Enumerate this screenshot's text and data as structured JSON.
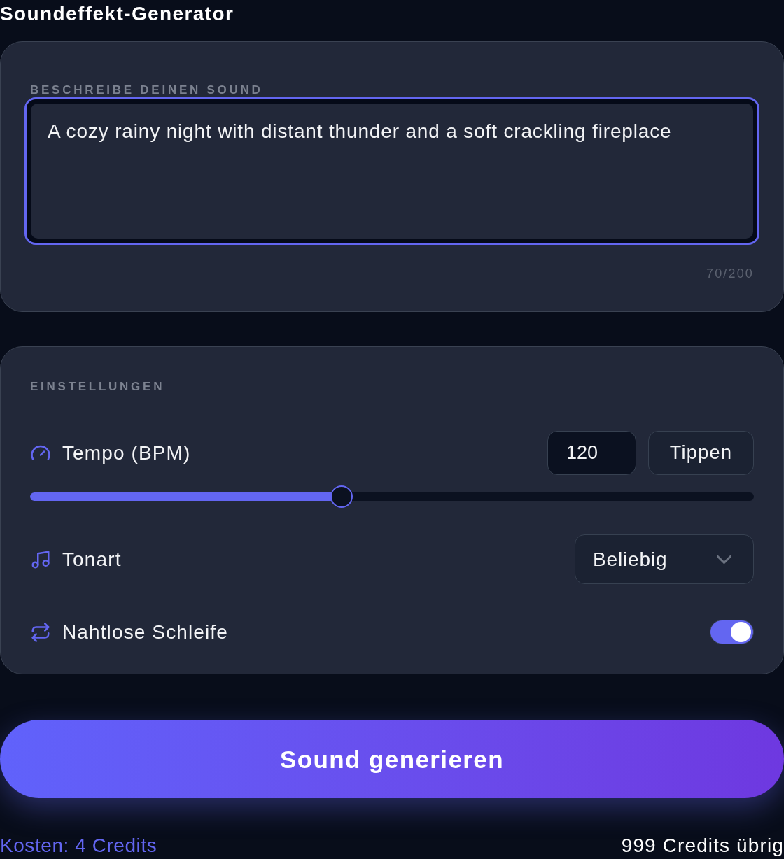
{
  "title": "Soundeffekt-Generator",
  "prompt_card": {
    "label": "BESCHREIBE DEINEN SOUND",
    "textarea": {
      "value": "A cozy rainy night with distant thunder and a soft crackling fireplace",
      "focused": true
    },
    "counter": "70/200"
  },
  "settings": {
    "label": "EINSTELLUNGEN",
    "rows": [
      {
        "kind": "tempo",
        "label": "Tempo (BPM)",
        "value": "120",
        "button": "Tippen",
        "level": 0.43
      },
      {
        "kind": "select",
        "label": "Tonart",
        "value": "Beliebig"
      },
      {
        "kind": "toggle",
        "label": "Nahtlose Schleife",
        "on": true
      }
    ]
  },
  "generate_button": "Sound generieren",
  "footer": {
    "cost": "Kosten: 4 Credits",
    "remaining": "999 Credits übrig"
  }
}
